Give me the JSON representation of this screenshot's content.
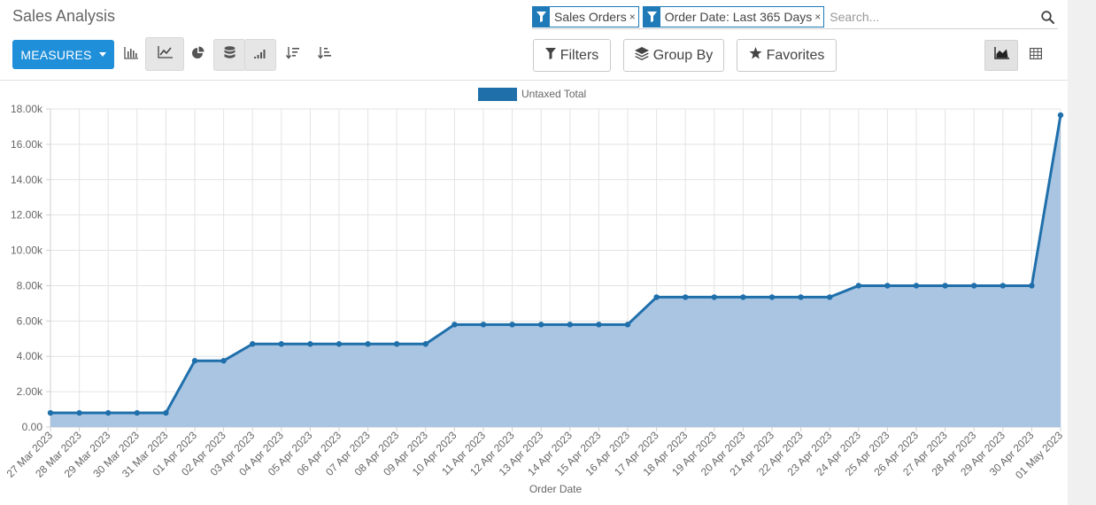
{
  "app": {
    "title": "Sales Analysis"
  },
  "search": {
    "facets": [
      {
        "value": "Sales Orders"
      },
      {
        "value": "Order Date: Last 365 Days"
      }
    ],
    "placeholder": "Search..."
  },
  "toolbar": {
    "measures_label": "MEASURES",
    "filters_label": "Filters",
    "groupby_label": "Group By",
    "favorites_label": "Favorites",
    "active_chart": "line",
    "stacked_active": true
  },
  "colors": {
    "accent": "#1f8fd9",
    "series_line": "#1f6fab",
    "series_fill": "#a9c5e2"
  },
  "chart_data": {
    "type": "area",
    "xlabel": "Order Date",
    "ylabel": "",
    "ylim": [
      0,
      18000
    ],
    "yticks": [
      "0.00",
      "2.00k",
      "4.00k",
      "6.00k",
      "8.00k",
      "10.00k",
      "12.00k",
      "14.00k",
      "16.00k",
      "18.00k"
    ],
    "legend": {
      "position": "top-center"
    },
    "grid": true,
    "categories": [
      "27 Mar 2023",
      "28 Mar 2023",
      "29 Mar 2023",
      "30 Mar 2023",
      "31 Mar 2023",
      "01 Apr 2023",
      "02 Apr 2023",
      "03 Apr 2023",
      "04 Apr 2023",
      "05 Apr 2023",
      "06 Apr 2023",
      "07 Apr 2023",
      "08 Apr 2023",
      "09 Apr 2023",
      "10 Apr 2023",
      "11 Apr 2023",
      "12 Apr 2023",
      "13 Apr 2023",
      "14 Apr 2023",
      "15 Apr 2023",
      "16 Apr 2023",
      "17 Apr 2023",
      "18 Apr 2023",
      "19 Apr 2023",
      "20 Apr 2023",
      "21 Apr 2023",
      "22 Apr 2023",
      "23 Apr 2023",
      "24 Apr 2023",
      "25 Apr 2023",
      "26 Apr 2023",
      "27 Apr 2023",
      "28 Apr 2023",
      "29 Apr 2023",
      "30 Apr 2023",
      "01 May 2023"
    ],
    "series": [
      {
        "name": "Untaxed Total",
        "values": [
          800,
          800,
          800,
          800,
          800,
          3750,
          3750,
          4700,
          4700,
          4700,
          4700,
          4700,
          4700,
          4700,
          5800,
          5800,
          5800,
          5800,
          5800,
          5800,
          5800,
          7350,
          7350,
          7350,
          7350,
          7350,
          7350,
          7350,
          8000,
          8000,
          8000,
          8000,
          8000,
          8000,
          8000,
          17650
        ]
      }
    ]
  }
}
